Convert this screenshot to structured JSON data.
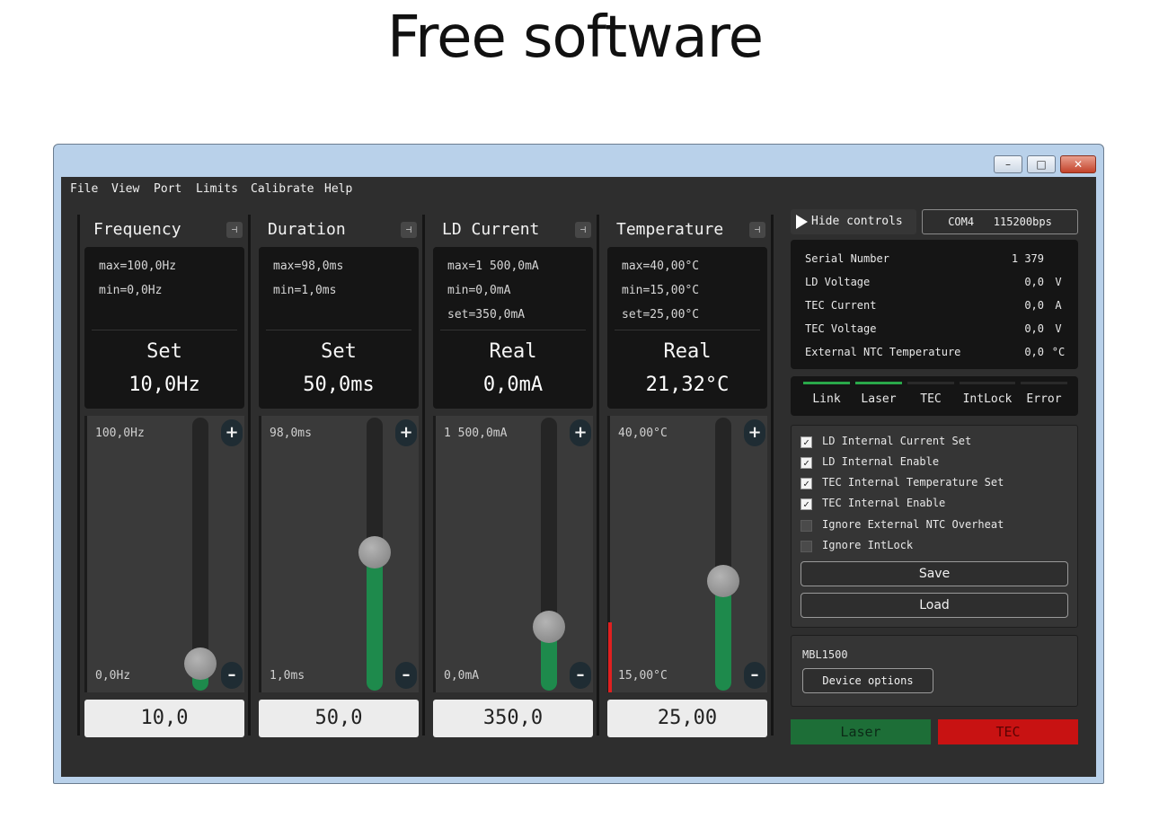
{
  "page_heading": "Free software",
  "window": {
    "buttons": {
      "minimize": "–",
      "maximize": "□",
      "close": "✕"
    }
  },
  "menu": [
    "File",
    "View",
    "Port",
    "Limits",
    "Calibrate",
    "Help"
  ],
  "columns": [
    {
      "title": "Frequency",
      "info": [
        "max=100,0Hz",
        "min=0,0Hz",
        ""
      ],
      "mode": "Set",
      "display": "10,0Hz",
      "slider_max_label": "100,0Hz",
      "slider_min_label": "0,0Hz",
      "slider_fraction": 0.1,
      "value": "10,0",
      "warning": false
    },
    {
      "title": "Duration",
      "info": [
        "max=98,0ms",
        "min=1,0ms",
        ""
      ],
      "mode": "Set",
      "display": "50,0ms",
      "slider_max_label": "98,0ms",
      "slider_min_label": "1,0ms",
      "slider_fraction": 0.505,
      "value": "50,0",
      "warning": false
    },
    {
      "title": "LD Current",
      "info": [
        "max=1 500,0mA",
        "min=0,0mA",
        "set=350,0mA"
      ],
      "mode": "Real",
      "display": "0,0mA",
      "slider_max_label": "1 500,0mA",
      "slider_min_label": "0,0mA",
      "slider_fraction": 0.233,
      "value": "350,0",
      "warning": false
    },
    {
      "title": "Temperature",
      "info": [
        "max=40,00°C",
        "min=15,00°C",
        "set=25,00°C"
      ],
      "mode": "Real",
      "display": "21,32°C",
      "slider_max_label": "40,00°C",
      "slider_min_label": "15,00°C",
      "slider_fraction": 0.4,
      "value": "25,00",
      "warning": true
    }
  ],
  "controls": {
    "hide_label": "Hide controls",
    "port_label": "COM4   115200bps"
  },
  "status": [
    {
      "label": "Serial Number",
      "value": "1 379",
      "unit": ""
    },
    {
      "label": "LD Voltage",
      "value": "0,0",
      "unit": "V"
    },
    {
      "label": "TEC Current",
      "value": "0,0",
      "unit": "A"
    },
    {
      "label": "TEC Voltage",
      "value": "0,0",
      "unit": "V"
    },
    {
      "label": "External NTC Temperature",
      "value": "0,0",
      "unit": "°C"
    }
  ],
  "indicators": [
    {
      "label": "Link",
      "on": true
    },
    {
      "label": "Laser",
      "on": true
    },
    {
      "label": "TEC",
      "on": false
    },
    {
      "label": "IntLock",
      "on": false
    },
    {
      "label": "Error",
      "on": false
    }
  ],
  "options": [
    {
      "label": "LD Internal Current Set",
      "checked": true,
      "mark": "✓"
    },
    {
      "label": "LD Internal Enable",
      "checked": true,
      "mark": "✓"
    },
    {
      "label": "TEC Internal Temperature Set",
      "checked": true,
      "mark": "✓"
    },
    {
      "label": "TEC Internal Enable",
      "checked": true,
      "mark": "✓"
    },
    {
      "label": "Ignore External NTC Overheat",
      "checked": false,
      "mark": ""
    },
    {
      "label": "Ignore IntLock",
      "checked": false,
      "mark": ""
    }
  ],
  "save_label": "Save",
  "load_label": "Load",
  "device": {
    "name": "MBL1500",
    "options_label": "Device options"
  },
  "laser_label": "Laser",
  "tec_label": "TEC",
  "plus_label": "+",
  "minus_label": "–",
  "pin_label": "⊣",
  "colors": {
    "fill": "#1e8a4c",
    "laser_button": "#1d6e37",
    "tec_button": "#c81212",
    "warning": "#e02020"
  }
}
